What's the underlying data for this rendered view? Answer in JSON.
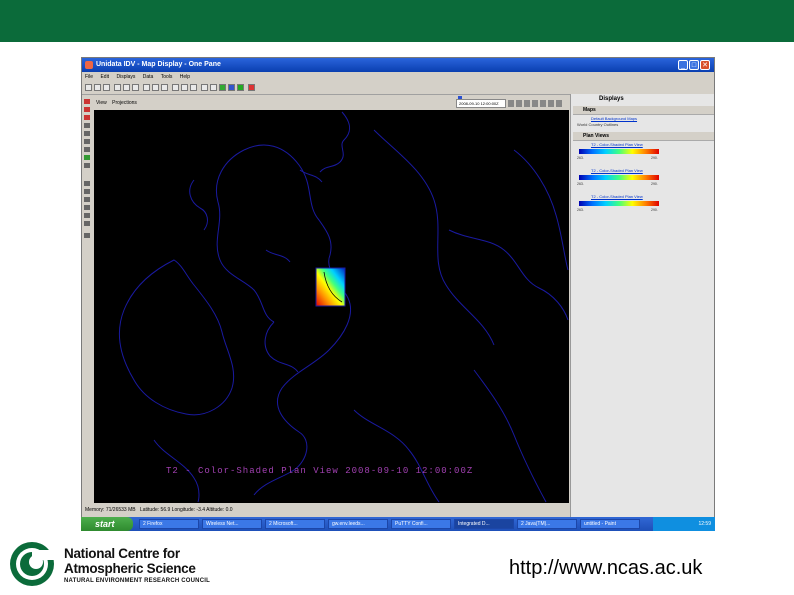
{
  "window": {
    "title": "Unidata IDV - Map Display - One Pane",
    "menus": [
      "File",
      "Edit",
      "Displays",
      "Data",
      "Tools",
      "Help"
    ],
    "minimize": "_",
    "maximize": "□",
    "close": "✕"
  },
  "view_bar": {
    "view_label": "View",
    "projections_label": "Projections"
  },
  "time": {
    "value": "2008-09-10 12:00:00Z"
  },
  "map": {
    "display_label": "T2 - Color-Shaded Plan View 2008-09-10 12:00:00Z"
  },
  "status": {
    "memory": "Memory: 71/26533 MB",
    "position": "Latitude: 56.9 Longitude: -3.4 Altitude: 0.0"
  },
  "displays_panel": {
    "title": "Displays",
    "maps_group": "Maps",
    "maps_item": "Default Background Maps",
    "maps_sub": "World Country Outlines",
    "plan_group": "Plan Views",
    "plan_items": [
      {
        "label": "T2 - Color-Shaded Plan View",
        "min": "263.",
        "max": "290."
      },
      {
        "label": "T2 - Color-Shaded Plan View",
        "min": "263.",
        "max": "290."
      },
      {
        "label": "T2 - Color-Shaded Plan View",
        "min": "263.",
        "max": "290."
      }
    ]
  },
  "taskbar": {
    "start": "start",
    "tasks": [
      "2 Firefox",
      "Wireless Net...",
      "2 Microsoft...",
      "gw.env.leeds...",
      "PuTTY Confi...",
      "Integrated D...",
      "2 Java(TM)...",
      "untitled - Paint"
    ],
    "clock": "12:59"
  },
  "footer": {
    "org_line1": "National Centre for",
    "org_line2": "Atmospheric Science",
    "org_line3": "NATURAL ENVIRONMENT RESEARCH COUNCIL",
    "url": "http://www.ncas.ac.uk"
  },
  "colors": {
    "banner": "#0b6b3a",
    "map_background": "#000000",
    "coastline": "#1a1aa0"
  }
}
